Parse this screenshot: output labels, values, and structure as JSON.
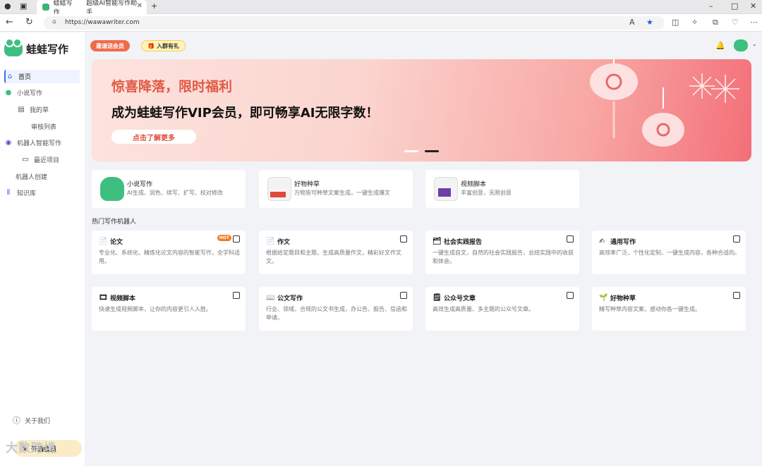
{
  "browser": {
    "tab1_title": "蛙蛙写作",
    "tab2_title": "超级AI智能写作助手",
    "url": "https://wawawriter.com"
  },
  "sidebar": {
    "logo_text": "蛙蛙写作",
    "items": [
      {
        "label": "首页"
      },
      {
        "label": "小说写作"
      },
      {
        "label": "我的草"
      },
      {
        "label": "审核列表"
      },
      {
        "label": "机器人智能写作"
      },
      {
        "label": "最近项目"
      },
      {
        "label": "机器人创建"
      },
      {
        "label": "知识库"
      }
    ],
    "about": "关于我们",
    "member": "开通会员"
  },
  "header": {
    "badge1": "邀请送会员",
    "badge2": "入群有礼"
  },
  "banner": {
    "headline": "惊喜降落，限时福利",
    "subline": "成为蛙蛙写作VIP会员，即可畅享AI无限字数！",
    "button": "点击了解更多"
  },
  "features": [
    {
      "title": "小说写作",
      "desc": "AI生成、润色、续写、扩写、校对修改"
    },
    {
      "title": "好物种草",
      "desc": "万物皆可种草文案生成，一键生成爆文"
    },
    {
      "title": "视频脚本",
      "desc": "丰富创意，无限创意"
    }
  ],
  "section_title": "热门写作机器人",
  "robots": [
    {
      "title": "论文",
      "desc": "专业化、系统化、精炼化论文内容的智能写作，全学科适用。",
      "hot": "HOT"
    },
    {
      "title": "作文",
      "desc": "根据给定题目和主题，生成高质量作文，精彩好文作文文。"
    },
    {
      "title": "社会实践报告",
      "desc": "一键生成自文，自然的社会实践报告，总结实践中的收获和体会。"
    },
    {
      "title": "通用写作",
      "desc": "高效率广泛，个性化定制，一键生成内容，各种合适的。"
    },
    {
      "title": "视频脚本",
      "desc": "快速生成视频脚本，让你的内容更引人入胜。"
    },
    {
      "title": "公文写作",
      "desc": "行业、领域，合规的公文书生成，办公告、报告、信函和申请。"
    },
    {
      "title": "公众号文章",
      "desc": "高效生成高质量、多主题的公众号文章。"
    },
    {
      "title": "好物种草",
      "desc": "精写种草内容文案，感动你各一键生成。"
    }
  ],
  "watermark": "大数跨境"
}
